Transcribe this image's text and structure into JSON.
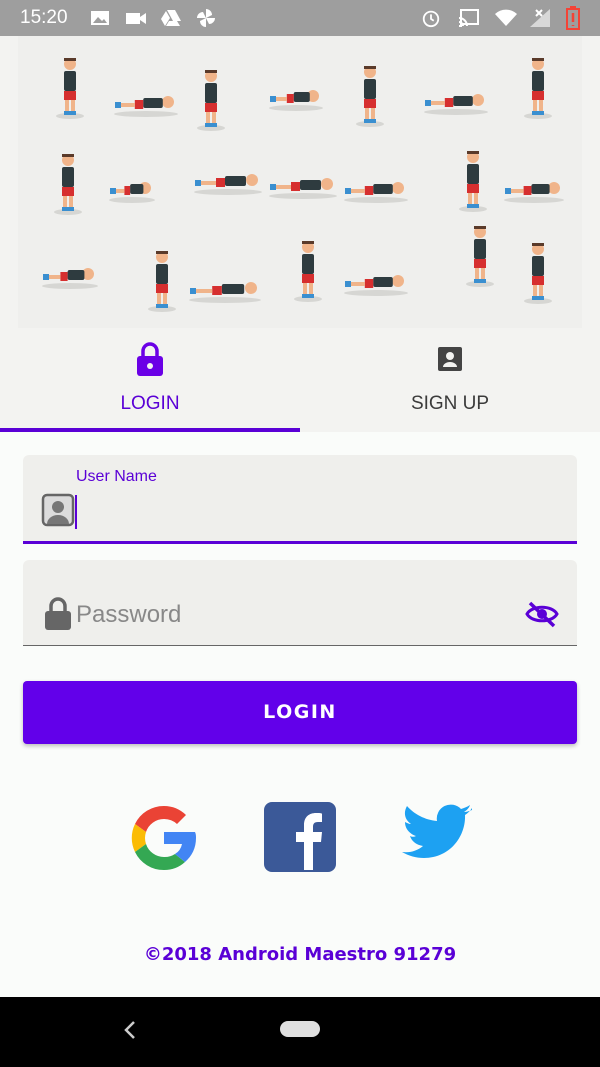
{
  "status_bar": {
    "time": "15:20"
  },
  "tabs": [
    {
      "label": "LOGIN",
      "icon": "lock-icon",
      "active": true
    },
    {
      "label": "SIGN UP",
      "icon": "contact-icon",
      "active": false
    }
  ],
  "form": {
    "username": {
      "label": "User Name",
      "value": "",
      "icon": "person-box-icon"
    },
    "password": {
      "placeholder": "Password",
      "icon": "lock-icon",
      "toggle_icon": "visibility-off-icon"
    }
  },
  "login_button": {
    "label": "LOGIN"
  },
  "social": [
    "google-logo",
    "facebook-logo",
    "twitter-logo"
  ],
  "footer": {
    "text": "©2018 Android Maestro 91279"
  },
  "colors": {
    "accent": "#5a00d6",
    "button": "#6200ea",
    "status_bar": "#9e9e9e"
  }
}
